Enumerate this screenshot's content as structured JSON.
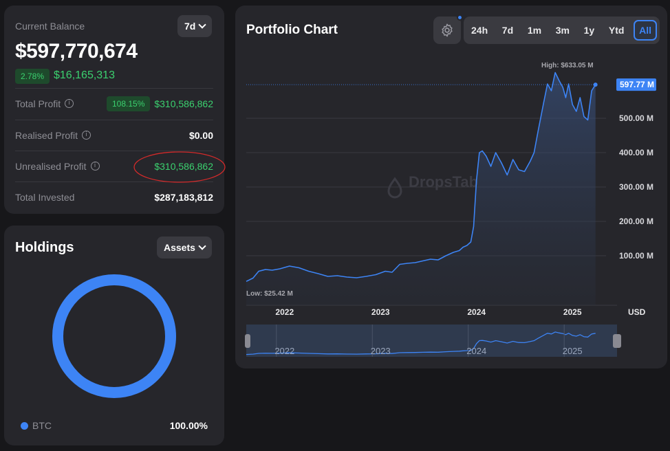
{
  "balance": {
    "label": "Current Balance",
    "period": "7d",
    "value": "$597,770,674",
    "change_pct": "2.78%",
    "change_value": "$16,165,313",
    "rows": [
      {
        "label": "Total Profit",
        "badge": "108.15%",
        "value": "$310,586,862"
      },
      {
        "label": "Realised Profit",
        "value": "$0.00"
      },
      {
        "label": "Unrealised Profit",
        "value": "$310,586,862"
      },
      {
        "label": "Total Invested",
        "value": "$287,183,812"
      }
    ]
  },
  "holdings": {
    "title": "Holdings",
    "filter": "Assets",
    "legend": [
      {
        "name": "BTC",
        "share": "100.00%",
        "fraction": 1.0
      }
    ],
    "colors": {
      "btc": "#3d84f5"
    }
  },
  "chart": {
    "title": "Portfolio Chart",
    "ranges": [
      "24h",
      "7d",
      "1m",
      "3m",
      "1y",
      "Ytd",
      "All"
    ],
    "active_range": "All",
    "watermark": "DropsTab",
    "high_label": "High: $633.05 M",
    "low_label": "Low: $25.42 M",
    "current_label": "597.77 M",
    "currency": "USD",
    "accent": "#3d84f5"
  },
  "chart_data": {
    "type": "line",
    "ylabel": "USD",
    "y_ticks": [
      "100.00 M",
      "200.00 M",
      "300.00 M",
      "400.00 M",
      "500.00 M"
    ],
    "y_tick_values": [
      100,
      200,
      300,
      400,
      500
    ],
    "x_ticks": [
      "2022",
      "2023",
      "2024",
      "2025"
    ],
    "x_tick_values": [
      2022.0,
      2023.0,
      2024.0,
      2025.0
    ],
    "ylim": [
      0,
      650
    ],
    "xlim": [
      2021.6,
      2025.35
    ],
    "high": 633.05,
    "low": 25.42,
    "current": 597.77,
    "series": [
      {
        "x": [
          2021.6,
          2021.67,
          2021.73,
          2021.8,
          2021.87,
          2021.95,
          2022.05,
          2022.15,
          2022.25,
          2022.35,
          2022.45,
          2022.55,
          2022.65,
          2022.75,
          2022.85,
          2022.95,
          2023.05,
          2023.12,
          2023.2,
          2023.28,
          2023.36,
          2023.44,
          2023.52,
          2023.6,
          2023.68,
          2023.76,
          2023.82,
          2023.86,
          2023.9,
          2023.94,
          2023.97,
          2024.0,
          2024.03,
          2024.06,
          2024.1,
          2024.15,
          2024.2,
          2024.26,
          2024.32,
          2024.38,
          2024.44,
          2024.5,
          2024.56,
          2024.6,
          2024.64,
          2024.7,
          2024.74,
          2024.78,
          2024.82,
          2024.86,
          2024.9,
          2024.93,
          2024.96,
          2025.0,
          2025.04,
          2025.08,
          2025.12,
          2025.16,
          2025.2,
          2025.24
        ],
        "y": [
          25.4,
          35,
          55,
          60,
          58,
          62,
          70,
          65,
          55,
          48,
          40,
          42,
          38,
          36,
          40,
          45,
          55,
          52,
          75,
          78,
          80,
          85,
          90,
          88,
          100,
          110,
          115,
          125,
          130,
          140,
          185,
          320,
          400,
          405,
          390,
          360,
          400,
          370,
          335,
          380,
          350,
          345,
          375,
          400,
          460,
          545,
          600,
          580,
          633,
          610,
          590,
          560,
          600,
          540,
          520,
          560,
          505,
          495,
          580,
          597.77
        ]
      }
    ]
  }
}
